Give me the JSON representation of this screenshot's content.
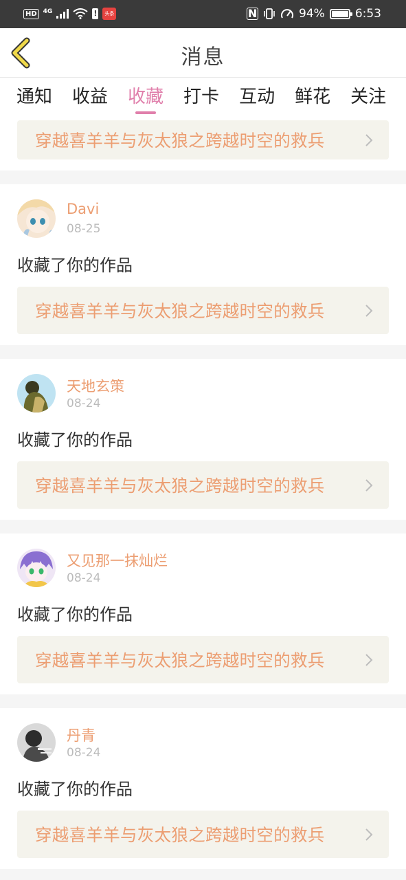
{
  "status_bar": {
    "hd": "HD",
    "signal": "4G",
    "app_badge": "头条",
    "nfc": "N",
    "battery": "94%",
    "time": "6:53"
  },
  "header": {
    "title": "消息",
    "back_icon": "chevron-left-icon"
  },
  "tabs": [
    {
      "label": "通知",
      "active": false
    },
    {
      "label": "收益",
      "active": false
    },
    {
      "label": "收藏",
      "active": true
    },
    {
      "label": "打卡",
      "active": false
    },
    {
      "label": "互动",
      "active": false
    },
    {
      "label": "鲜花",
      "active": false
    },
    {
      "label": "关注",
      "active": false
    }
  ],
  "top_partial": {
    "work_title": "穿越喜羊羊与灰太狼之跨越时空的救兵"
  },
  "messages": [
    {
      "username": "Davi",
      "date": "08-25",
      "action": "收藏了你的作品",
      "work_title": "穿越喜羊羊与灰太狼之跨越时空的救兵"
    },
    {
      "username": "天地玄策",
      "date": "08-24",
      "action": "收藏了你的作品",
      "work_title": "穿越喜羊羊与灰太狼之跨越时空的救兵"
    },
    {
      "username": "又见那一抹灿烂",
      "date": "08-24",
      "action": "收藏了你的作品",
      "work_title": "穿越喜羊羊与灰太狼之跨越时空的救兵"
    },
    {
      "username": "丹青",
      "date": "08-24",
      "action": "收藏了你的作品",
      "work_title": "穿越喜羊羊与灰太狼之跨越时空的救兵"
    }
  ],
  "colors": {
    "accent": "#e07fab",
    "work_title": "#ec9e72",
    "work_bg": "#f4f3ec",
    "back_icon": "#f0d94a"
  }
}
